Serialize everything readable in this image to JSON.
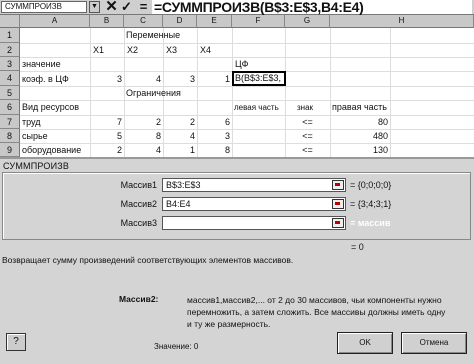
{
  "formula_bar": {
    "name_box": "СУММПРОИЗВ",
    "cancel": "✕",
    "enter": "✓",
    "equals": "=",
    "formula": "=СУММПРОИЗВ(B$3:E$3,B4:E4)"
  },
  "sheet": {
    "col_headers": [
      "A",
      "B",
      "C",
      "D",
      "E",
      "F",
      "G",
      "H"
    ],
    "row_headers": [
      "1",
      "2",
      "3",
      "4",
      "5",
      "6",
      "7",
      "8",
      "9"
    ],
    "title_vars": "Переменные",
    "vars": [
      "X1",
      "X2",
      "X3",
      "X4"
    ],
    "row3_label": "значение",
    "row3_f": "ЦФ",
    "row4_label": "коэф. в ЦФ",
    "row4_values": [
      "3",
      "4",
      "3",
      "1"
    ],
    "row4_f": "В(В$3:Е$3,",
    "title_constraints": "Ограничения",
    "row6_label": "Вид ресурсов",
    "row6_f": "левая часть",
    "row6_g": "знак",
    "row6_h": "правая часть",
    "rows": [
      {
        "label": "труд",
        "values": [
          "7",
          "2",
          "2",
          "6"
        ],
        "sign": "<=",
        "rhs": "80"
      },
      {
        "label": "сырье",
        "values": [
          "5",
          "8",
          "4",
          "3"
        ],
        "sign": "<=",
        "rhs": "480"
      },
      {
        "label": "оборудование",
        "values": [
          "2",
          "4",
          "1",
          "8"
        ],
        "sign": "<=",
        "rhs": "130"
      }
    ]
  },
  "dialog": {
    "title": "СУММПРОИЗВ",
    "args": [
      {
        "label": "Массив1",
        "value": "B$3:E$3",
        "result": "= {0;0;0;0}"
      },
      {
        "label": "Массив2",
        "value": "B4:E4",
        "result": "= {3;4;3;1}"
      },
      {
        "label": "Массив3",
        "value": "",
        "result": "= массив"
      }
    ],
    "result": "= 0",
    "description": "Возвращает сумму произведений соответствующих элементов массивов.",
    "arg_name": "Массив2:",
    "arg_description": "массив1,массив2,... от 2 до 30 массивов, чьи компоненты нужно перемножить, а затем сложить. Все массивы должны иметь одну и ту же размерность.",
    "help": "?",
    "value_label": "Значение: 0",
    "ok": "OK",
    "cancel": "Отмена"
  }
}
